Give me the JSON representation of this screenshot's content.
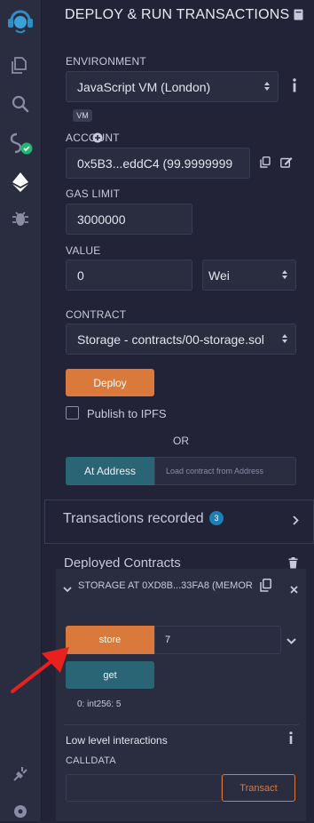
{
  "header": {
    "title": "DEPLOY & RUN TRANSACTIONS"
  },
  "environment": {
    "label": "ENVIRONMENT",
    "value": "JavaScript VM (London)",
    "badge": "VM"
  },
  "account": {
    "label": "ACCOUNT",
    "value": "0x5B3...eddC4 (99.9999999"
  },
  "gas": {
    "label": "GAS LIMIT",
    "value": "3000000"
  },
  "value": {
    "label": "VALUE",
    "amount": "0",
    "unit": "Wei"
  },
  "contract": {
    "label": "CONTRACT",
    "value": "Storage - contracts/00-storage.sol"
  },
  "deploy": {
    "label": "Deploy"
  },
  "publish": {
    "label": "Publish to IPFS",
    "checked": false
  },
  "or_text": "OR",
  "at_address": {
    "label": "At Address",
    "placeholder": "Load contract from Address"
  },
  "transactions": {
    "label": "Transactions recorded",
    "count": "3"
  },
  "deployed": {
    "title": "Deployed Contracts",
    "instance": {
      "name": "STORAGE AT 0XD8B...33FA8 (MEMOR",
      "store_label": "store",
      "store_value": "7",
      "get_label": "get",
      "get_output": "0: int256: 5"
    },
    "low_level": {
      "title": "Low level interactions",
      "calldata_label": "CALLDATA",
      "transact_label": "Transact"
    }
  },
  "colors": {
    "accent_orange": "#d97a3c",
    "accent_blue": "#2a6576",
    "badge_blue": "#1f7fb8",
    "success_green": "#20b673",
    "arrow_red": "#e8201e"
  }
}
